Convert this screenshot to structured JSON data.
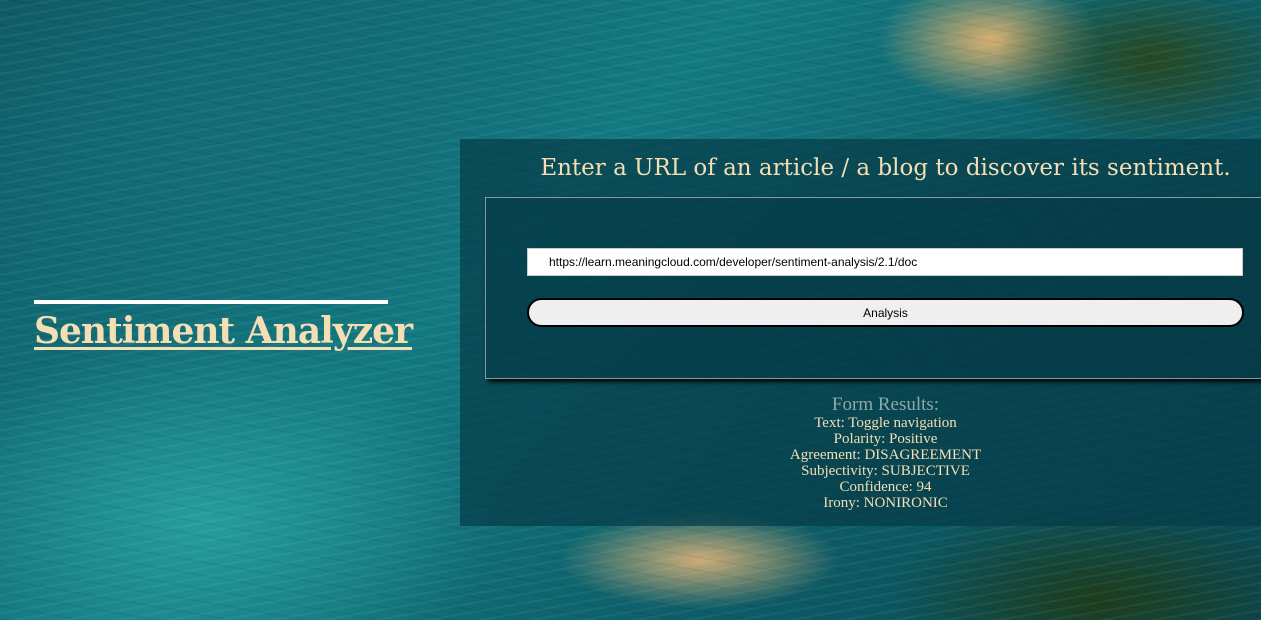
{
  "app": {
    "title": "Sentiment Analyzer"
  },
  "form": {
    "heading": "Enter a URL of an article / a blog to discover its sentiment.",
    "url_value": "https://learn.meaningcloud.com/developer/sentiment-analysis/2.1/doc",
    "submit_label": "Analysis"
  },
  "results": {
    "title": "Form Results:",
    "text": "Text: Toggle navigation",
    "polarity": "Polarity: Positive",
    "agreement": "Agreement: DISAGREEMENT",
    "subjectivity": "Subjectivity: SUBJECTIVE",
    "confidence": "Confidence: 94",
    "irony": "Irony: NONIRONIC"
  },
  "colors": {
    "accent_text": "#f5deb3",
    "panel_bg": "#063c48",
    "button_bg": "#efefef"
  }
}
